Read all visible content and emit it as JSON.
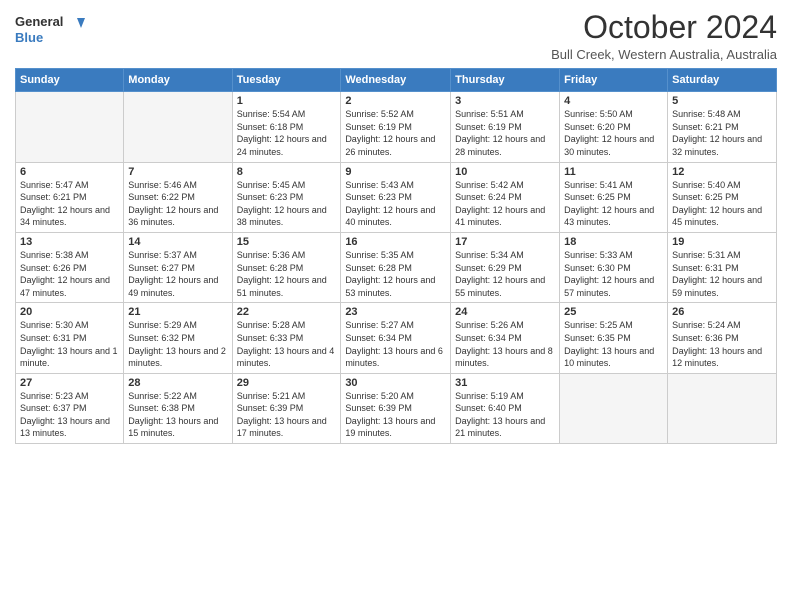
{
  "header": {
    "logo_line1": "General",
    "logo_line2": "Blue",
    "month": "October 2024",
    "location": "Bull Creek, Western Australia, Australia"
  },
  "weekdays": [
    "Sunday",
    "Monday",
    "Tuesday",
    "Wednesday",
    "Thursday",
    "Friday",
    "Saturday"
  ],
  "weeks": [
    [
      {
        "day": "",
        "empty": true
      },
      {
        "day": "",
        "empty": true
      },
      {
        "day": "1",
        "sunrise": "5:54 AM",
        "sunset": "6:18 PM",
        "daylight": "12 hours and 24 minutes."
      },
      {
        "day": "2",
        "sunrise": "5:52 AM",
        "sunset": "6:19 PM",
        "daylight": "12 hours and 26 minutes."
      },
      {
        "day": "3",
        "sunrise": "5:51 AM",
        "sunset": "6:19 PM",
        "daylight": "12 hours and 28 minutes."
      },
      {
        "day": "4",
        "sunrise": "5:50 AM",
        "sunset": "6:20 PM",
        "daylight": "12 hours and 30 minutes."
      },
      {
        "day": "5",
        "sunrise": "5:48 AM",
        "sunset": "6:21 PM",
        "daylight": "12 hours and 32 minutes."
      }
    ],
    [
      {
        "day": "6",
        "sunrise": "5:47 AM",
        "sunset": "6:21 PM",
        "daylight": "12 hours and 34 minutes."
      },
      {
        "day": "7",
        "sunrise": "5:46 AM",
        "sunset": "6:22 PM",
        "daylight": "12 hours and 36 minutes."
      },
      {
        "day": "8",
        "sunrise": "5:45 AM",
        "sunset": "6:23 PM",
        "daylight": "12 hours and 38 minutes."
      },
      {
        "day": "9",
        "sunrise": "5:43 AM",
        "sunset": "6:23 PM",
        "daylight": "12 hours and 40 minutes."
      },
      {
        "day": "10",
        "sunrise": "5:42 AM",
        "sunset": "6:24 PM",
        "daylight": "12 hours and 41 minutes."
      },
      {
        "day": "11",
        "sunrise": "5:41 AM",
        "sunset": "6:25 PM",
        "daylight": "12 hours and 43 minutes."
      },
      {
        "day": "12",
        "sunrise": "5:40 AM",
        "sunset": "6:25 PM",
        "daylight": "12 hours and 45 minutes."
      }
    ],
    [
      {
        "day": "13",
        "sunrise": "5:38 AM",
        "sunset": "6:26 PM",
        "daylight": "12 hours and 47 minutes."
      },
      {
        "day": "14",
        "sunrise": "5:37 AM",
        "sunset": "6:27 PM",
        "daylight": "12 hours and 49 minutes."
      },
      {
        "day": "15",
        "sunrise": "5:36 AM",
        "sunset": "6:28 PM",
        "daylight": "12 hours and 51 minutes."
      },
      {
        "day": "16",
        "sunrise": "5:35 AM",
        "sunset": "6:28 PM",
        "daylight": "12 hours and 53 minutes."
      },
      {
        "day": "17",
        "sunrise": "5:34 AM",
        "sunset": "6:29 PM",
        "daylight": "12 hours and 55 minutes."
      },
      {
        "day": "18",
        "sunrise": "5:33 AM",
        "sunset": "6:30 PM",
        "daylight": "12 hours and 57 minutes."
      },
      {
        "day": "19",
        "sunrise": "5:31 AM",
        "sunset": "6:31 PM",
        "daylight": "12 hours and 59 minutes."
      }
    ],
    [
      {
        "day": "20",
        "sunrise": "5:30 AM",
        "sunset": "6:31 PM",
        "daylight": "13 hours and 1 minute."
      },
      {
        "day": "21",
        "sunrise": "5:29 AM",
        "sunset": "6:32 PM",
        "daylight": "13 hours and 2 minutes."
      },
      {
        "day": "22",
        "sunrise": "5:28 AM",
        "sunset": "6:33 PM",
        "daylight": "13 hours and 4 minutes."
      },
      {
        "day": "23",
        "sunrise": "5:27 AM",
        "sunset": "6:34 PM",
        "daylight": "13 hours and 6 minutes."
      },
      {
        "day": "24",
        "sunrise": "5:26 AM",
        "sunset": "6:34 PM",
        "daylight": "13 hours and 8 minutes."
      },
      {
        "day": "25",
        "sunrise": "5:25 AM",
        "sunset": "6:35 PM",
        "daylight": "13 hours and 10 minutes."
      },
      {
        "day": "26",
        "sunrise": "5:24 AM",
        "sunset": "6:36 PM",
        "daylight": "13 hours and 12 minutes."
      }
    ],
    [
      {
        "day": "27",
        "sunrise": "5:23 AM",
        "sunset": "6:37 PM",
        "daylight": "13 hours and 13 minutes."
      },
      {
        "day": "28",
        "sunrise": "5:22 AM",
        "sunset": "6:38 PM",
        "daylight": "13 hours and 15 minutes."
      },
      {
        "day": "29",
        "sunrise": "5:21 AM",
        "sunset": "6:39 PM",
        "daylight": "13 hours and 17 minutes."
      },
      {
        "day": "30",
        "sunrise": "5:20 AM",
        "sunset": "6:39 PM",
        "daylight": "13 hours and 19 minutes."
      },
      {
        "day": "31",
        "sunrise": "5:19 AM",
        "sunset": "6:40 PM",
        "daylight": "13 hours and 21 minutes."
      },
      {
        "day": "",
        "empty": true
      },
      {
        "day": "",
        "empty": true
      }
    ]
  ]
}
